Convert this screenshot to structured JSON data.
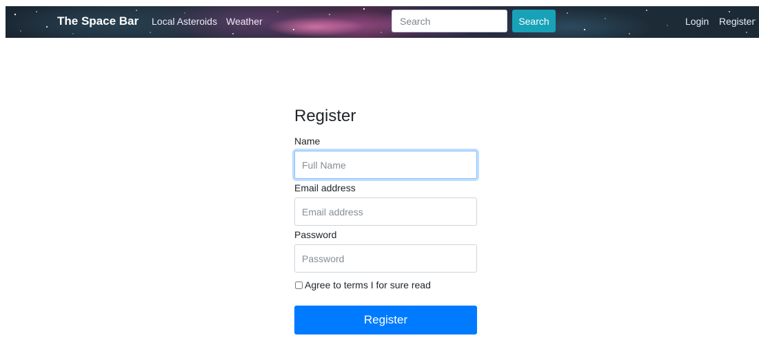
{
  "navbar": {
    "brand": "The Space Bar",
    "links": [
      "Local Asteroids",
      "Weather"
    ],
    "search_placeholder": "Search",
    "search_button": "Search",
    "login": "Login",
    "register": "Register"
  },
  "form": {
    "title": "Register",
    "name_label": "Name",
    "name_placeholder": "Full Name",
    "email_label": "Email address",
    "email_placeholder": "Email address",
    "password_label": "Password",
    "password_placeholder": "Password",
    "terms_label": "Agree to terms I for sure read",
    "terms_checked": false,
    "submit_label": "Register"
  },
  "colors": {
    "primary": "#007bff",
    "info": "#17a2b8",
    "focus_border": "#80bdff"
  }
}
